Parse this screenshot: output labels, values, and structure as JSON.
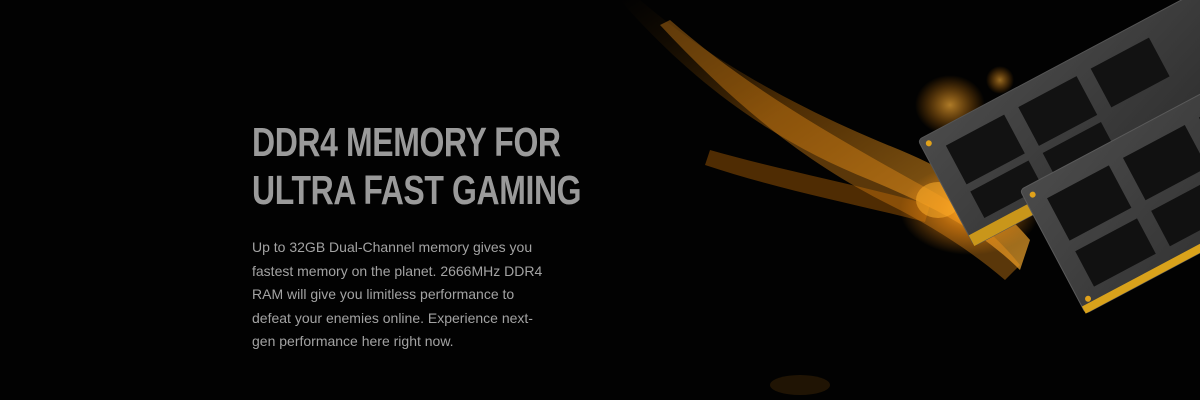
{
  "hero": {
    "headline_line1": "DDR4 MEMORY FOR",
    "headline_line2": "ULTRA FAST GAMING",
    "body": "Up to 32GB Dual-Channel memory gives you fastest memory on the planet. 2666MHz DDR4 RAM will give you limitless performance to defeat your enemies online. Experience next-gen performance here right now."
  },
  "art": {
    "image": "ram-modules-image",
    "glow": "orange-glow-swoosh"
  },
  "colors": {
    "background": "#020202",
    "headline": "#9a9a9a",
    "body": "#a3a3a3",
    "glow": "#ff9a1a",
    "pcb": "#3a3a3a",
    "chip": "#111111",
    "contacts": "#d9a21b"
  }
}
